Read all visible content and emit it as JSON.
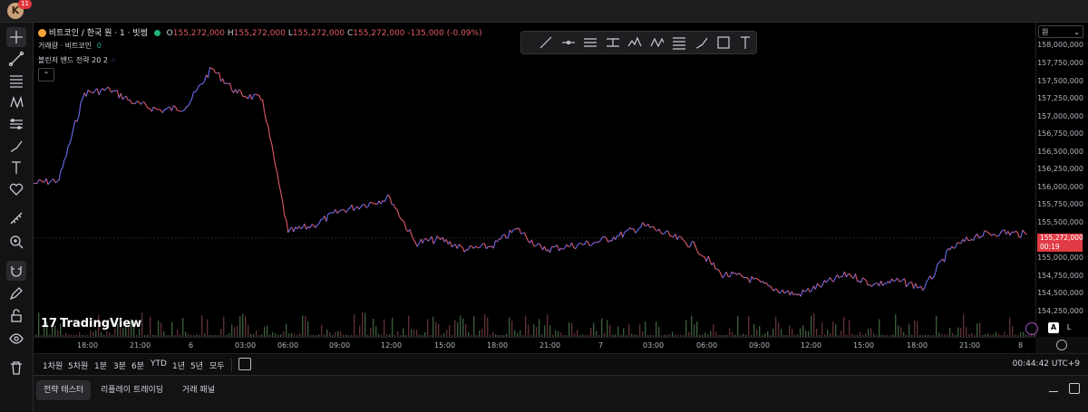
{
  "user": {
    "avatar_letter": "K",
    "notification_count": "11"
  },
  "legend": {
    "symbol_title": "비트코인 / 한국 원 · 1 · 빗썸",
    "open_label": "O",
    "open_value": "155,272,000",
    "high_label": "H",
    "high_value": "155,272,000",
    "low_label": "L",
    "low_value": "155,272,000",
    "close_label": "C",
    "close_value": "155,272,000",
    "change": "-135,000 (-0.09%)",
    "volume_label": "거래량 · 비트코인",
    "volume_value": "0",
    "indicator_label": "볼린저 밴드 전략",
    "indicator_params": "20 2"
  },
  "price_axis": {
    "currency_unit": "원",
    "ticks": [
      "158,000,000",
      "157,750,000",
      "157,500,000",
      "157,250,000",
      "157,000,000",
      "156,750,000",
      "156,500,000",
      "156,250,000",
      "156,000,000",
      "155,750,000",
      "155,500,000",
      "155,000,000",
      "154,750,000",
      "154,500,000",
      "154,250,000"
    ],
    "current_price": "155,272,000",
    "countdown": "00:19"
  },
  "time_axis": {
    "ticks": [
      "18:00",
      "21:00",
      "6",
      "03:00",
      "06:00",
      "09:00",
      "12:00",
      "15:00",
      "18:00",
      "21:00",
      "7",
      "03:00",
      "06:00",
      "09:00",
      "12:00",
      "15:00",
      "18:00",
      "21:00",
      "8"
    ]
  },
  "scale_buttons": {
    "auto": "A",
    "log": "L"
  },
  "timeframes": [
    "1차원",
    "5차원",
    "1분",
    "3분",
    "6분",
    "YTD",
    "1년",
    "5년",
    "모두"
  ],
  "clock": "00:44:42 UTC+9",
  "bottom_tabs": [
    "전략 테스터",
    "리플레이 트레이딩",
    "거래 패널"
  ],
  "watermark": "TradingView",
  "colors": {
    "up": "#e05a6a",
    "down": "#6b6cf0",
    "price_badge": "#e03b44"
  },
  "chart_data": {
    "type": "line",
    "title": "비트코인 / 한국 원 · 1 · 빗썸",
    "xlabel": "",
    "ylabel": "",
    "ylim": [
      154150000,
      158050000
    ],
    "x": [
      "16:30",
      "17:00",
      "18:00",
      "19:00",
      "20:00",
      "21:00",
      "21:30",
      "22:00",
      "22:30",
      "23:00",
      "6 00:00",
      "01:00",
      "03:00",
      "05:00",
      "06:00",
      "06:30",
      "08:00",
      "09:00",
      "11:00",
      "12:00",
      "13:00",
      "15:00",
      "18:00",
      "21:00",
      "7 00:00",
      "01:00",
      "02:00",
      "03:00",
      "06:00",
      "07:00",
      "09:00",
      "12:00",
      "13:00",
      "15:00",
      "16:00",
      "17:00",
      "18:00",
      "21:00",
      "23:00",
      "8 00:00"
    ],
    "series": [
      {
        "values": [
          156000000,
          156050000,
          157300000,
          157350000,
          157150000,
          157050000,
          157100000,
          157650000,
          157300000,
          157200000,
          155300000,
          155400000,
          155600000,
          155700000,
          155800000,
          155150000,
          155200000,
          155050000,
          155100000,
          155350000,
          155050000,
          155100000,
          155150000,
          155250000,
          155400000,
          155250000,
          155100000,
          154700000,
          154650000,
          154500000,
          154400000,
          154550000,
          154700000,
          154550000,
          154600000,
          154500000,
          155050000,
          155250000,
          155300000,
          155272000
        ]
      }
    ]
  }
}
